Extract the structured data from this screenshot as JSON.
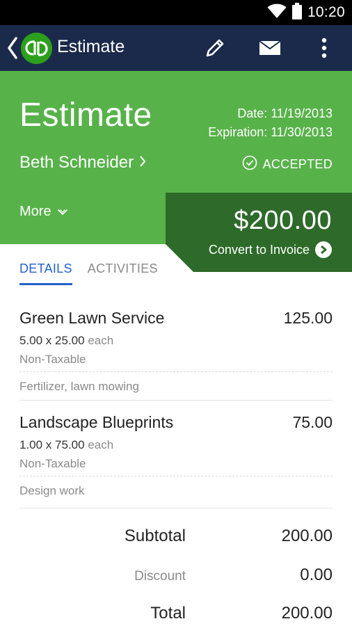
{
  "status_bar": {
    "time": "10:20"
  },
  "app_bar": {
    "title": "Estimate"
  },
  "estimate": {
    "heading": "Estimate",
    "date": "Date: 11/19/2013",
    "expiration": "Expiration: 11/30/2013",
    "customer": "Beth Schneider",
    "status": "ACCEPTED",
    "more_label": "More",
    "amount": "$200.00",
    "convert_label": "Convert to Invoice"
  },
  "tabs": [
    {
      "label": "DETAILS",
      "active": true
    },
    {
      "label": "ACTIVITIES",
      "active": false
    }
  ],
  "line_items": [
    {
      "name": "Green Lawn Service",
      "amount": "125.00",
      "qty": "5.00 x 25.00",
      "each": "each",
      "tax": "Non-Taxable",
      "description": "Fertilizer, lawn mowing"
    },
    {
      "name": "Landscape Blueprints",
      "amount": "75.00",
      "qty": "1.00 x 75.00",
      "each": "each",
      "tax": "Non-Taxable",
      "description": "Design work"
    }
  ],
  "totals": {
    "subtotal_label": "Subtotal",
    "subtotal": "200.00",
    "discount_label": "Discount",
    "discount": "0.00",
    "total_label": "Total",
    "total": "200.00"
  },
  "colors": {
    "header_green": "#58b24a",
    "card_green": "#2e6a2a",
    "app_bar": "#1b2a4a",
    "tab_active": "#2461c6",
    "qb_brand": "#2ca01c"
  },
  "icons": {
    "wifi": "wifi-icon",
    "battery": "battery-icon",
    "back": "back-chevron-icon",
    "logo": "quickbooks-logo",
    "edit": "pencil-icon",
    "mail": "mail-icon",
    "overflow": "overflow-menu-icon",
    "check": "check-circle-icon",
    "customer_chevron": "chevron-right-icon",
    "more_chevron": "chevron-down-icon",
    "convert": "arrow-circle-right-icon"
  }
}
